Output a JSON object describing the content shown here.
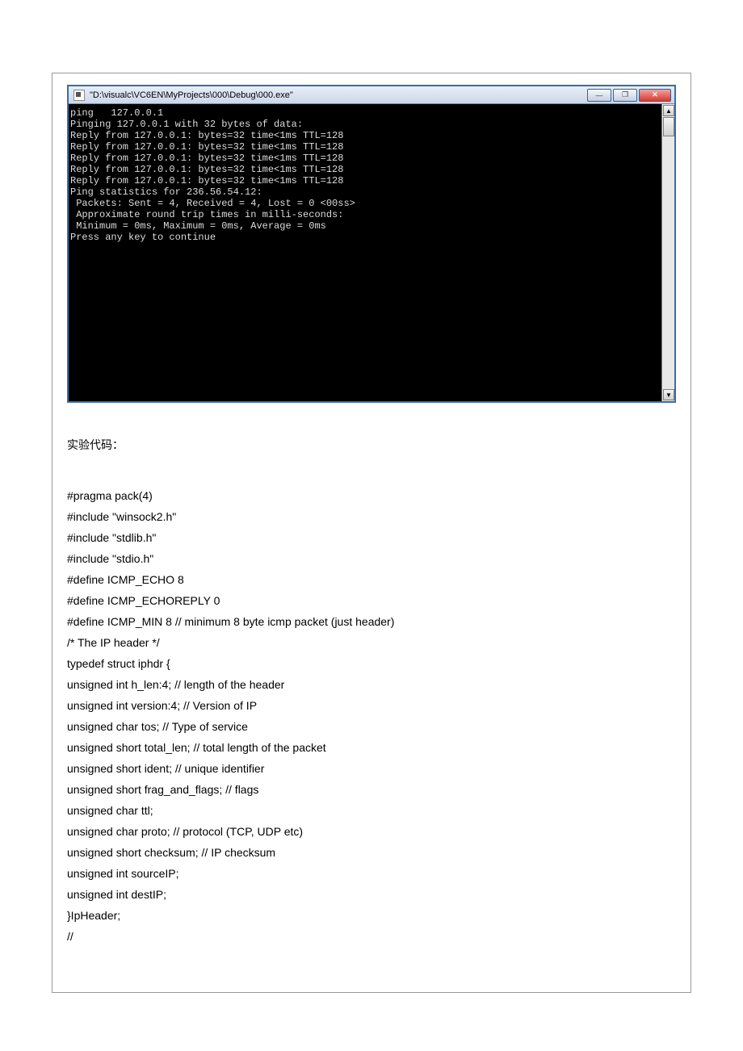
{
  "console": {
    "title": "\"D:\\visualc\\VC6EN\\MyProjects\\000\\Debug\\000.exe\"",
    "output": "ping   127.0.0.1\nPinging 127.0.0.1 with 32 bytes of data:\nReply from 127.0.0.1: bytes=32 time<1ms TTL=128\nReply from 127.0.0.1: bytes=32 time<1ms TTL=128\nReply from 127.0.0.1: bytes=32 time<1ms TTL=128\nReply from 127.0.0.1: bytes=32 time<1ms TTL=128\nReply from 127.0.0.1: bytes=32 time<1ms TTL=128\nPing statistics for 236.56.54.12:\n Packets: Sent = 4, Received = 4, Lost = 0 <00ss>\n Approximate round trip times in milli-seconds:\n Minimum = 0ms, Maximum = 0ms, Average = 0ms\nPress any key to continue"
  },
  "section": {
    "heading": "实验代码："
  },
  "code_lines": [
    "#pragma pack(4)",
    "#include   \"winsock2.h\"",
    "#include   \"stdlib.h\"",
    "#include   \"stdio.h\"",
    "#define ICMP_ECHO 8",
    "#define ICMP_ECHOREPLY 0",
    "#define ICMP_MIN 8 // minimum 8 byte icmp packet (just header)",
    "/* The IP header */",
    "typedef struct iphdr {",
    "unsigned int h_len:4; // length of the header",
    "unsigned int version:4; // Version of IP",
    "unsigned char tos; // Type of service",
    "unsigned short total_len; // total length of the packet",
    "unsigned short ident; // unique identifier",
    "unsigned short frag_and_flags; // flags",
    "unsigned char ttl;",
    "unsigned char proto; // protocol (TCP, UDP etc)",
    "unsigned short checksum; // IP checksum",
    "unsigned int sourceIP;",
    "unsigned int destIP;",
    "}IpHeader;",
    "//"
  ],
  "buttons": {
    "minimize": "—",
    "maximize": "❐",
    "close": "✕",
    "up": "▲",
    "down": "▼"
  }
}
